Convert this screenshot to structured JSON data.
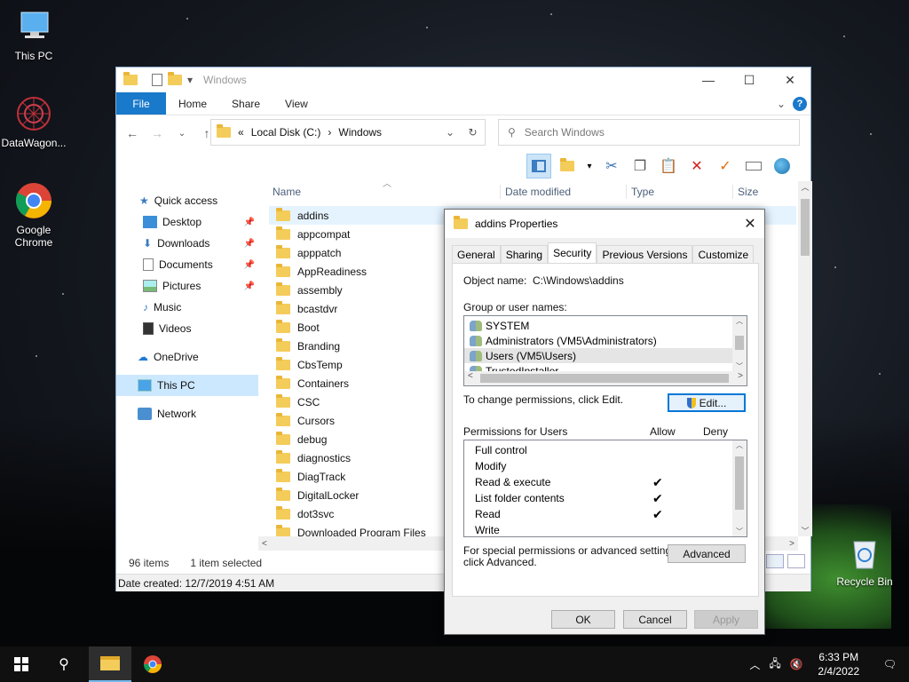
{
  "desktop": {
    "icons": [
      {
        "label": "This PC"
      },
      {
        "label": "DataWagon..."
      },
      {
        "label": "Google Chrome"
      },
      {
        "label": "Recycle Bin"
      }
    ]
  },
  "explorer": {
    "title": "Windows",
    "ribbon_tabs": [
      "File",
      "Home",
      "Share",
      "View"
    ],
    "address": {
      "prefix": "«",
      "crumbs": [
        "Local Disk (C:)",
        "Windows"
      ]
    },
    "search_placeholder": "Search Windows",
    "sidebar": [
      {
        "label": "Quick access",
        "icon": "star-icon"
      },
      {
        "label": "Desktop",
        "icon": "desktop-icon",
        "pinned": true
      },
      {
        "label": "Downloads",
        "icon": "download-icon",
        "pinned": true
      },
      {
        "label": "Documents",
        "icon": "document-icon",
        "pinned": true
      },
      {
        "label": "Pictures",
        "icon": "picture-icon",
        "pinned": true
      },
      {
        "label": "Music",
        "icon": "music-icon"
      },
      {
        "label": "Videos",
        "icon": "video-icon"
      },
      {
        "label": "OneDrive",
        "icon": "cloud-icon"
      },
      {
        "label": "This PC",
        "icon": "pc-icon",
        "selected": true
      },
      {
        "label": "Network",
        "icon": "network-icon"
      }
    ],
    "columns": [
      "Name",
      "Date modified",
      "Type",
      "Size"
    ],
    "files": [
      "addins",
      "appcompat",
      "apppatch",
      "AppReadiness",
      "assembly",
      "bcastdvr",
      "Boot",
      "Branding",
      "CbsTemp",
      "Containers",
      "CSC",
      "Cursors",
      "debug",
      "diagnostics",
      "DiagTrack",
      "DigitalLocker",
      "dot3svc",
      "Downloaded Program Files"
    ],
    "selected_file": "addins",
    "status": {
      "count": "96 items",
      "selection": "1 item selected"
    },
    "details": "Date created: 12/7/2019 4:51 AM"
  },
  "dialog": {
    "title": "addins Properties",
    "tabs": [
      "General",
      "Sharing",
      "Security",
      "Previous Versions",
      "Customize"
    ],
    "active_tab": "Security",
    "object_label": "Object name:",
    "object_value": "C:\\Windows\\addins",
    "group_label": "Group or user names:",
    "groups": [
      "SYSTEM",
      "Administrators (VM5\\Administrators)",
      "Users (VM5\\Users)",
      "TrustedInstaller"
    ],
    "selected_group": "Users (VM5\\Users)",
    "change_hint": "To change permissions, click Edit.",
    "edit_label": "Edit...",
    "perm_header": "Permissions for Users",
    "allow_label": "Allow",
    "deny_label": "Deny",
    "permissions": [
      {
        "name": "Full control",
        "allow": false,
        "deny": false
      },
      {
        "name": "Modify",
        "allow": false,
        "deny": false
      },
      {
        "name": "Read & execute",
        "allow": true,
        "deny": false
      },
      {
        "name": "List folder contents",
        "allow": true,
        "deny": false
      },
      {
        "name": "Read",
        "allow": true,
        "deny": false
      },
      {
        "name": "Write",
        "allow": false,
        "deny": false
      }
    ],
    "advanced_hint_1": "For special permissions or advanced settings,",
    "advanced_hint_2": "click Advanced.",
    "advanced_label": "Advanced",
    "ok_label": "OK",
    "cancel_label": "Cancel",
    "apply_label": "Apply"
  },
  "taskbar": {
    "time": "6:33 PM",
    "date": "2/4/2022"
  },
  "colors": {
    "accent": "#1979ca",
    "selection": "#cce8ff",
    "focus": "#0078d7"
  }
}
